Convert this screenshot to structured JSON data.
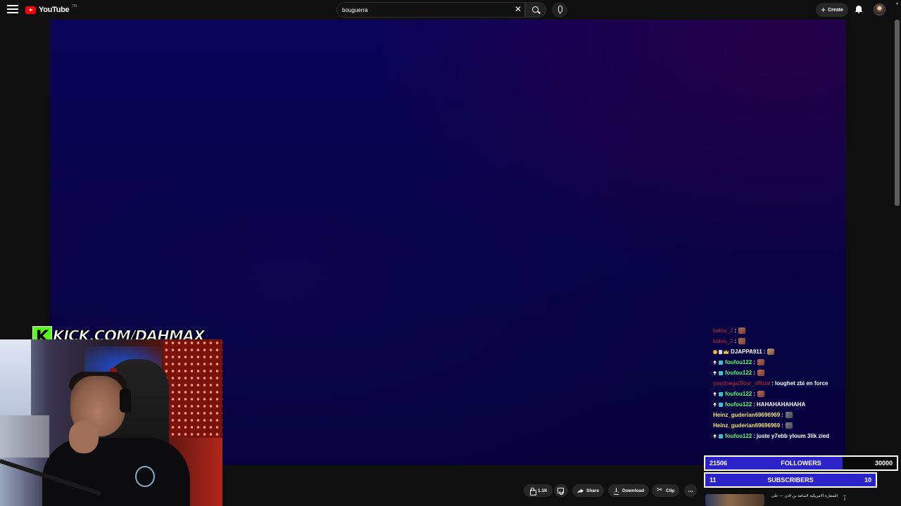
{
  "app": {
    "name": "YouTube",
    "country_sup": "TN"
  },
  "search": {
    "value": "bouguerra",
    "placeholder": "Search"
  },
  "header": {
    "create_label": "Create"
  },
  "actions": {
    "like_count": "1.1K",
    "share_label": "Share",
    "download_label": "Download",
    "clip_label": "Clip",
    "more_label": "..."
  },
  "overlay": {
    "kick_letter": "K",
    "kick_url": "KICK.COM/DAHMAX",
    "chat": [
      {
        "user": "katou_2",
        "sep": ":",
        "message": "",
        "color": "#c62a3b",
        "badges": [],
        "emote": "red"
      },
      {
        "user": "katou_2",
        "sep": ":",
        "message": "",
        "color": "#c62a3b",
        "badges": [],
        "emote": "red"
      },
      {
        "user": "DJAPPA911",
        "sep": ":",
        "message": "",
        "color": "#ffffff",
        "badges": [
          "orange",
          "key",
          "crown"
        ],
        "emote": "knife"
      },
      {
        "user": "foufou122",
        "sep": ":",
        "message": "",
        "color": "#4cff6e",
        "badges": [
          "arrow",
          "shield"
        ],
        "emote": "red"
      },
      {
        "user": "foufou122",
        "sep": ":",
        "message": "",
        "color": "#4cff6e",
        "badges": [
          "arrow",
          "shield"
        ],
        "emote": "red"
      },
      {
        "user": "yassinega3four_official",
        "sep": ":",
        "message": "loughet zbi en force",
        "color": "#c62a3b",
        "badges": [],
        "emote": ""
      },
      {
        "user": "foufou122",
        "sep": ":",
        "message": "",
        "color": "#4cff6e",
        "badges": [
          "arrow",
          "shield"
        ],
        "emote": "red"
      },
      {
        "user": "foufou122",
        "sep": ":",
        "message": "HAHAHAHAHAHA",
        "color": "#4cff6e",
        "badges": [
          "arrow",
          "shield"
        ],
        "emote": ""
      },
      {
        "user": "Heinz_guderian69696969",
        "sep": ":",
        "message": "",
        "color": "#f0e27a",
        "badges": [],
        "emote": "cat"
      },
      {
        "user": "Heinz_guderian69696969",
        "sep": ":",
        "message": "",
        "color": "#f0e27a",
        "badges": [],
        "emote": "cat"
      },
      {
        "user": "foufou122",
        "sep": ":",
        "message": "juste y7ebb yloum 3lik zied",
        "color": "#4cff6e",
        "badges": [
          "arrow",
          "shield"
        ],
        "emote": ""
      }
    ],
    "followers_goal": {
      "current": "21506",
      "label": "FOLLOWERS",
      "target": "30000",
      "progress": 0.717
    },
    "subscribers_goal": {
      "current": "11",
      "label": "SUBSCRIBERS",
      "target": "10",
      "progress": 1.0
    }
  },
  "related": {
    "title": "السفارة الأمريكية لأسامة بن لادن — على"
  },
  "colors": {
    "kick_green": "#53fc18",
    "goal_blue": "#2c22c9",
    "youtube_red": "#ff0000"
  }
}
